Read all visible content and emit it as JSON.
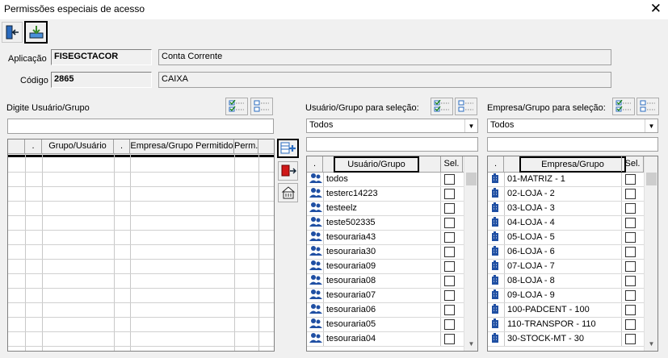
{
  "window": {
    "title": "Permissões especiais de acesso",
    "close_glyph": "✕"
  },
  "toolbar": {
    "exit_icon": "exit-door-icon",
    "save_icon": "save-tray-icon"
  },
  "app": {
    "aplicacao_label": "Aplicação",
    "aplicacao_code": "FISEGCTACOR",
    "aplicacao_desc": "Conta Corrente",
    "codigo_label": "Código",
    "codigo_value": "2865",
    "codigo_desc": "CAIXA"
  },
  "left": {
    "label": "Digite Usuário/Grupo",
    "columns": [
      ".",
      "Grupo/Usuário",
      ".",
      "Empresa/Grupo Permitido",
      "Perm."
    ]
  },
  "middle": {
    "label": "Usuário/Grupo para seleção:",
    "filter": "Todos",
    "columns": [
      ".",
      "Usuário/Grupo",
      "Sel."
    ],
    "rows": [
      "todos",
      "testerc14223",
      "testeelz",
      "teste502335",
      "tesouraria43",
      "tesouraria30",
      "tesouraria09",
      "tesouraria08",
      "tesouraria07",
      "tesouraria06",
      "tesouraria05",
      "tesouraria04"
    ]
  },
  "right": {
    "label": "Empresa/Grupo para seleção:",
    "filter": "Todos",
    "columns": [
      ".",
      "Empresa/Grupo",
      "Sel."
    ],
    "rows": [
      "01-MATRIZ - 1",
      "02-LOJA - 2",
      "03-LOJA - 3",
      "04-LOJA - 4",
      "05-LOJA - 5",
      "06-LOJA - 6",
      "07-LOJA - 7",
      "08-LOJA - 8",
      "09-LOJA - 9",
      "100-PADCENT - 100",
      "110-TRANSPOR - 110",
      "30-STOCK-MT - 30"
    ]
  },
  "colors": {
    "user_icon": "#1f4fa3",
    "company_icon": "#1f4fa3",
    "exit_red": "#d01818"
  }
}
